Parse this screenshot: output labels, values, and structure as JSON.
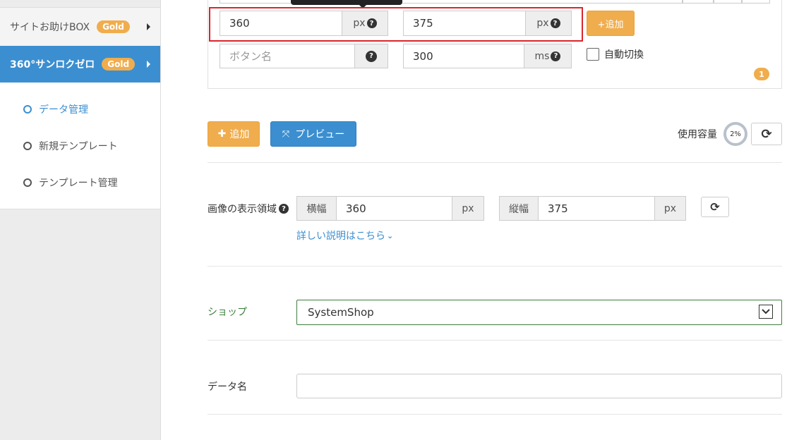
{
  "sidebar": {
    "items": [
      {
        "label": "サイトお助けBOX",
        "badge": "Gold"
      },
      {
        "label": "360°サンロクゼロ",
        "badge": "Gold"
      }
    ],
    "sub_items": [
      {
        "label": "データ管理"
      },
      {
        "label": "新規テンプレート"
      },
      {
        "label": "テンプレート管理"
      }
    ]
  },
  "panel": {
    "width_value": "360",
    "width_unit": "px",
    "height_value": "375",
    "height_unit": "px",
    "add_small_label": "+追加",
    "button_name_placeholder": "ボタン名",
    "interval_value": "300",
    "interval_unit": "ms",
    "auto_switch_label": "自動切換",
    "count_badge": "1",
    "help_glyph": "?"
  },
  "toolbar": {
    "add_label": "追加",
    "preview_label": "プレビュー",
    "capacity_label": "使用容量",
    "capacity_percent": "2%",
    "capacity_fraction": 0.02
  },
  "display_area": {
    "label": "画像の表示領域",
    "width_label": "横幅",
    "width_value": "360",
    "width_unit": "px",
    "height_label": "縦幅",
    "height_value": "375",
    "height_unit": "px",
    "details_link": "詳しい説明はこちら"
  },
  "shop": {
    "label": "ショップ",
    "selected": "SystemShop"
  },
  "data_name": {
    "label": "データ名",
    "value": ""
  },
  "colors": {
    "accent_blue": "#3b8fd0",
    "accent_orange": "#f0ad4e",
    "highlight_red": "#d9262c",
    "shop_green": "#3e7f3e"
  }
}
